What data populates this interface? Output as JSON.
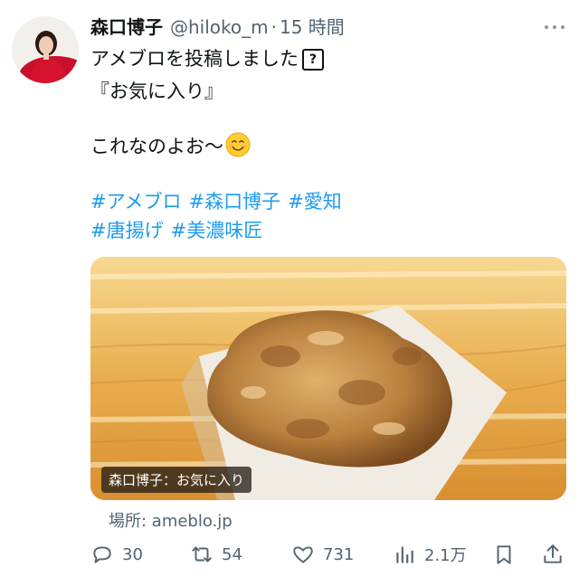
{
  "tweet": {
    "display_name": "森口博子",
    "handle": "@hiloko_m",
    "separator": "·",
    "time": "15 時間",
    "line1": "アメブロを投稿しました",
    "line1_symbol": "?",
    "line2": "『お気に入り』",
    "line3": "これなのよお～",
    "line3_emoji": "smiling-face-emoji",
    "hashtags_row1": [
      "#アメブロ",
      "#森口博子",
      "#愛知"
    ],
    "hashtags_row2": [
      "#唐揚げ",
      "#美濃味匠"
    ],
    "link_color": "#1d9bf0"
  },
  "card": {
    "label": "森口博子：お気に入り",
    "image": "fried-chicken-photo",
    "source": "場所: ameblo.jp"
  },
  "actions": {
    "replies": "30",
    "retweets": "54",
    "likes": "731",
    "views": "2.1万"
  },
  "icons": {
    "more": "more-dots-icon",
    "reply": "reply-icon",
    "retweet": "retweet-icon",
    "like": "heart-icon",
    "views": "views-icon",
    "bookmark": "bookmark-icon",
    "share": "share-icon"
  }
}
